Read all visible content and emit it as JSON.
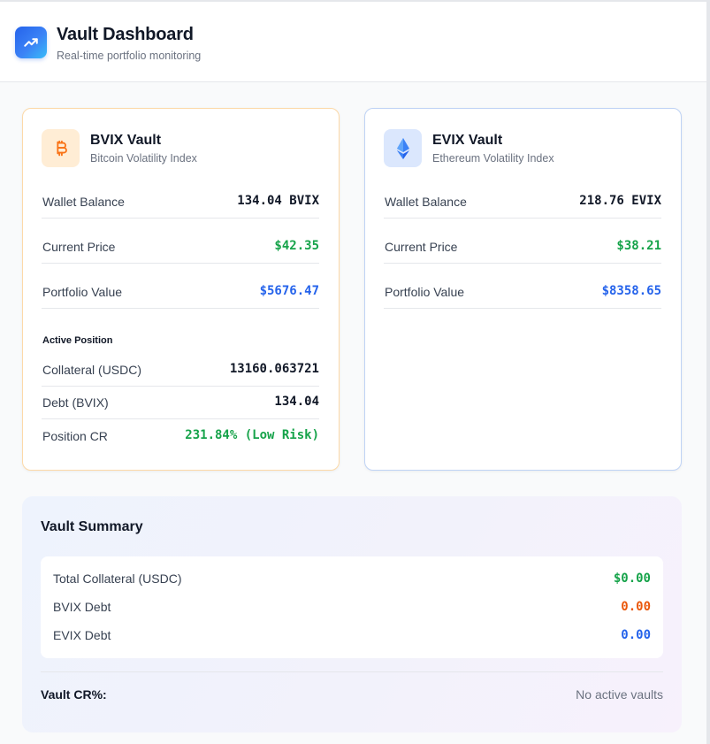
{
  "header": {
    "title": "Vault Dashboard",
    "subtitle": "Real-time portfolio monitoring",
    "logo_icon": "trending-up-icon",
    "accent": "#2563eb"
  },
  "vaults": [
    {
      "title": "BVIX Vault",
      "subtitle": "Bitcoin Volatility Index",
      "icon": "bitcoin-icon",
      "accent": "#f97316",
      "rows": [
        {
          "label": "Wallet Balance",
          "value": "134.04 BVIX"
        },
        {
          "label": "Current Price",
          "value": "$42.35"
        },
        {
          "label": "Portfolio Value",
          "value": "$5676.47"
        }
      ],
      "position": {
        "heading": "Active Position",
        "rows": [
          {
            "label": "Collateral (USDC)",
            "value": "13160.063721"
          },
          {
            "label": "Debt (BVIX)",
            "value": "134.04"
          },
          {
            "label": "Position CR",
            "value": "231.84% (Low Risk)"
          }
        ]
      }
    },
    {
      "title": "EVIX Vault",
      "subtitle": "Ethereum Volatility Index",
      "icon": "ethereum-icon",
      "accent": "#3b82f6",
      "rows": [
        {
          "label": "Wallet Balance",
          "value": "218.76 EVIX"
        },
        {
          "label": "Current Price",
          "value": "$38.21"
        },
        {
          "label": "Portfolio Value",
          "value": "$8358.65"
        }
      ]
    }
  ],
  "summary": {
    "title": "Vault Summary",
    "rows": [
      {
        "label": "Total Collateral (USDC)",
        "value": "$0.00"
      },
      {
        "label": "BVIX Debt",
        "value": "0.00"
      },
      {
        "label": "EVIX Debt",
        "value": "0.00"
      }
    ],
    "cr_label": "Vault CR%:",
    "cr_value": "No active vaults"
  },
  "colors": {
    "positive": "#16a34a",
    "value_blue": "#2563eb",
    "bvix_debt": "#ea580c"
  }
}
